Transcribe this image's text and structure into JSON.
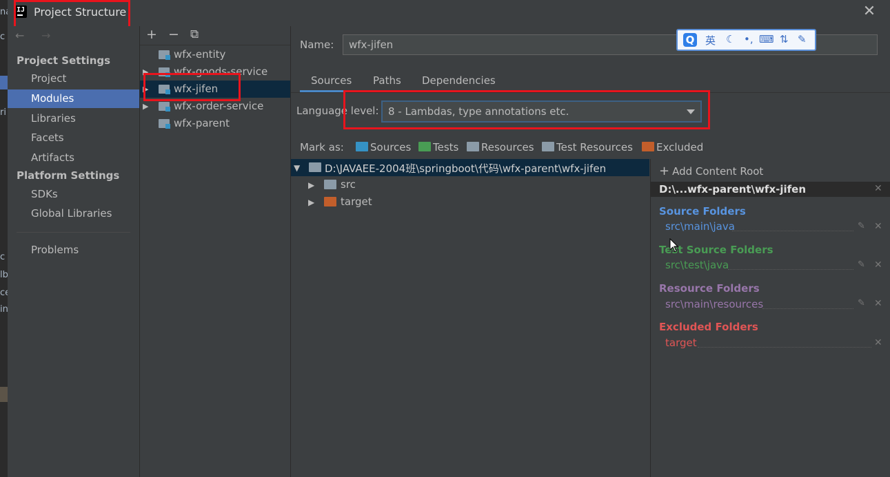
{
  "window": {
    "title": "Project Structure",
    "close_glyph": "✕"
  },
  "background_fragments": [
    "na",
    "c",
    "ri",
    "c",
    "lb",
    "ce",
    "in"
  ],
  "sidebar": {
    "project_settings_header": "Project Settings",
    "platform_settings_header": "Platform Settings",
    "items": [
      {
        "label": "Project"
      },
      {
        "label": "Modules",
        "selected": true
      },
      {
        "label": "Libraries"
      },
      {
        "label": "Facets"
      },
      {
        "label": "Artifacts"
      }
    ],
    "platform_items": [
      {
        "label": "SDKs"
      },
      {
        "label": "Global Libraries"
      }
    ],
    "problems_label": "Problems"
  },
  "modules_toolbar": {
    "add": "+",
    "remove": "−",
    "copy": "⧉"
  },
  "modules": [
    {
      "label": "wfx-entity",
      "expandable": false
    },
    {
      "label": "wfx-goods-service",
      "expandable": true
    },
    {
      "label": "wfx-jifen",
      "expandable": true,
      "selected": true
    },
    {
      "label": "wfx-order-service",
      "expandable": true
    },
    {
      "label": "wfx-parent",
      "expandable": false
    }
  ],
  "name_field": {
    "label": "Name:",
    "value": "wfx-jifen"
  },
  "ime": {
    "logo": "Q",
    "lang": "英",
    "moon": "☾",
    "punct": "•,",
    "keyboard": "⌨",
    "split": "⇅",
    "tools": "✎"
  },
  "tabs": [
    {
      "label": "Sources",
      "active": true
    },
    {
      "label": "Paths"
    },
    {
      "label": "Dependencies"
    }
  ],
  "language_level": {
    "label": "Language level:",
    "value": "8 - Lambdas, type annotations etc."
  },
  "mark_as": {
    "label": "Mark as:",
    "items": [
      {
        "label": "Sources",
        "color": "#3592c4"
      },
      {
        "label": "Tests",
        "color": "#499c54"
      },
      {
        "label": "Resources",
        "color": "#8b9ba8"
      },
      {
        "label": "Test Resources",
        "color": "#8b9ba8"
      },
      {
        "label": "Excluded",
        "color": "#c25e2b"
      }
    ]
  },
  "tree": {
    "root": "D:\\JAVAEE-2004班\\springboot\\代码\\wfx-parent\\wfx-jifen",
    "children": [
      {
        "label": "src",
        "color": "#8b9ba8"
      },
      {
        "label": "target",
        "color": "#c25e2b"
      }
    ]
  },
  "content_roots": {
    "add_label": "Add Content Root",
    "root_path": "D:\\...wfx-parent\\wfx-jifen",
    "categories": [
      {
        "title": "Source Folders",
        "path": "src\\main\\java",
        "color": "#5894e0",
        "editable": true
      },
      {
        "title": "Test Source Folders",
        "path": "src\\test\\java",
        "color": "#499c54",
        "editable": true
      },
      {
        "title": "Resource Folders",
        "path": "src\\main\\resources",
        "color": "#9876aa",
        "editable": true
      },
      {
        "title": "Excluded Folders",
        "path": "target",
        "color": "#e05555",
        "editable": false
      }
    ]
  },
  "colors": {
    "accent": "#4b6eaf",
    "highlight": "#e8141d"
  }
}
